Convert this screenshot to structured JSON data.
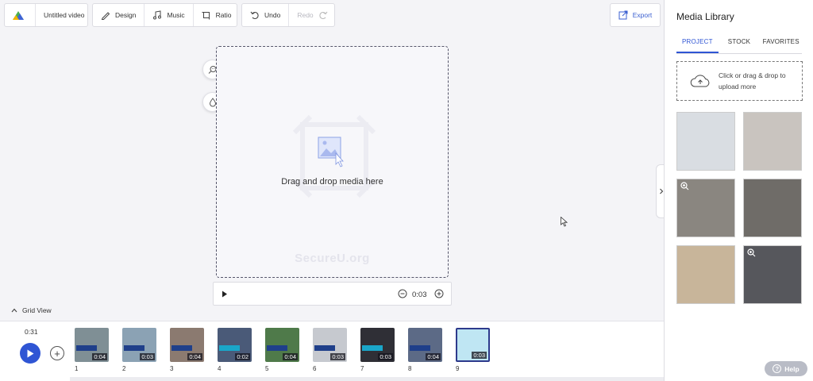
{
  "toolbar": {
    "video_title": "Untitled video",
    "design_label": "Design",
    "music_label": "Music",
    "ratio_label": "Ratio",
    "undo_label": "Undo",
    "redo_label": "Redo",
    "export_label": "Export",
    "icons": [
      "app-logo-icon",
      "pencil-icon",
      "music-note-icon",
      "crop-icon",
      "undo-icon",
      "redo-icon",
      "export-icon"
    ]
  },
  "canvas": {
    "drop_label": "Drag and drop media here",
    "watermark": "SecureU.org",
    "tools": [
      "magnify-face-icon",
      "droplet-icon"
    ]
  },
  "player": {
    "zoom_value": "0:03"
  },
  "grid_view_label": "Grid View",
  "timeline": {
    "total_time": "0:31",
    "clips": [
      {
        "number": "1",
        "duration": "0:04",
        "bg": "#7f8f95",
        "banner": "#1f3f8a"
      },
      {
        "number": "2",
        "duration": "0:03",
        "bg": "#8ba2b4",
        "banner": "#1f3f8a"
      },
      {
        "number": "3",
        "duration": "0:04",
        "bg": "#8b7a70",
        "banner": "#1f3f8a"
      },
      {
        "number": "4",
        "duration": "0:02",
        "bg": "#4a5a78",
        "banner": "#1aa6c9"
      },
      {
        "number": "5",
        "duration": "0:04",
        "bg": "#4f7a4a",
        "banner": "#1f3f8a"
      },
      {
        "number": "6",
        "duration": "0:03",
        "bg": "#c6c9cf",
        "banner": "#1f3f8a"
      },
      {
        "number": "7",
        "duration": "0:03",
        "bg": "#2f2f36",
        "banner": "#1aa6c9"
      },
      {
        "number": "8",
        "duration": "0:04",
        "bg": "#5c6a86",
        "banner": "#1f3f8a"
      },
      {
        "number": "9",
        "duration": "0:03",
        "bg": "#bfe6f3",
        "banner": ""
      }
    ]
  },
  "media_library": {
    "title": "Media Library",
    "tabs": [
      "PROJECT",
      "STOCK",
      "FAVORITES"
    ],
    "active_tab": "PROJECT",
    "upload_text": "Click or drag & drop to upload more",
    "thumbnails": [
      {
        "bg": "#d9dde2",
        "zoom": false
      },
      {
        "bg": "#c9c4bf",
        "zoom": false
      },
      {
        "bg": "#8a8680",
        "zoom": true
      },
      {
        "bg": "#6f6c68",
        "zoom": false
      },
      {
        "bg": "#c8b59a",
        "zoom": false
      },
      {
        "bg": "#56575c",
        "zoom": true
      }
    ]
  },
  "help_label": "Help",
  "colors": {
    "accent": "#2f55d4",
    "selected_clip_border": "#2d3a8c"
  }
}
